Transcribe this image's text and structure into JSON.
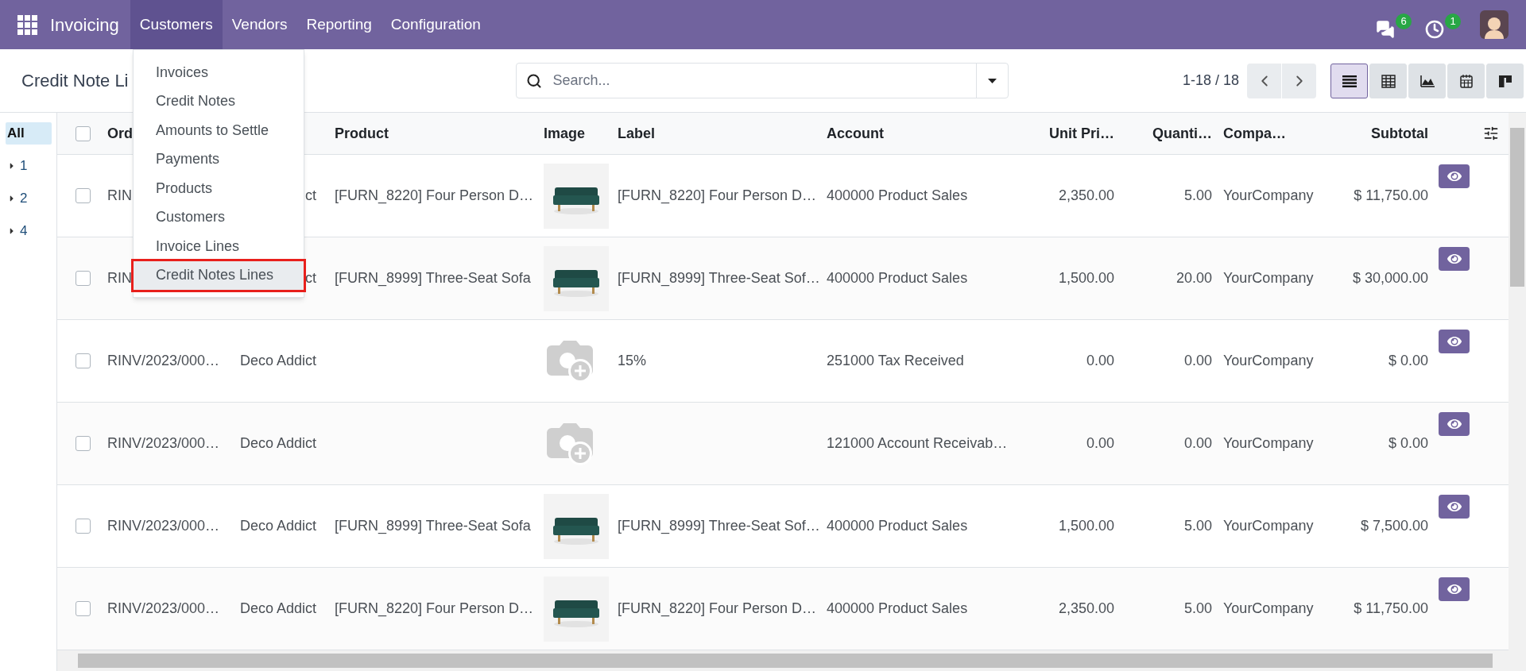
{
  "navbar": {
    "app_name": "Invoicing",
    "menus": [
      {
        "label": "Customers",
        "selected": true
      },
      {
        "label": "Vendors",
        "selected": false
      },
      {
        "label": "Reporting",
        "selected": false
      },
      {
        "label": "Configuration",
        "selected": false
      }
    ],
    "notifications": [
      {
        "kind": "chat",
        "count": "6"
      },
      {
        "kind": "activity",
        "count": "1"
      }
    ]
  },
  "customers_menu": {
    "items": [
      {
        "label": "Invoices",
        "selected": false,
        "highlighted": false
      },
      {
        "label": "Credit Notes",
        "selected": false,
        "highlighted": false
      },
      {
        "label": "Amounts to Settle",
        "selected": false,
        "highlighted": false
      },
      {
        "label": "Payments",
        "selected": false,
        "highlighted": false
      },
      {
        "label": "Products",
        "selected": false,
        "highlighted": false
      },
      {
        "label": "Customers",
        "selected": false,
        "highlighted": false
      },
      {
        "label": "Invoice Lines",
        "selected": false,
        "highlighted": false
      },
      {
        "label": "Credit Notes Lines",
        "selected": true,
        "highlighted": true
      }
    ]
  },
  "control_panel": {
    "title": "Credit Note Li",
    "search": {
      "placeholder": "Search..."
    },
    "pager": "1-18 / 18",
    "views": [
      {
        "kind": "list",
        "selected": true
      },
      {
        "kind": "pivot",
        "selected": false
      },
      {
        "kind": "graph",
        "selected": false
      },
      {
        "kind": "calendar",
        "selected": false
      },
      {
        "kind": "kanban",
        "selected": false
      }
    ]
  },
  "sidebar": {
    "items": [
      {
        "label": "All",
        "selected": true,
        "expandable": false
      },
      {
        "label": "1",
        "selected": false,
        "expandable": true
      },
      {
        "label": "2",
        "selected": false,
        "expandable": true
      },
      {
        "label": "4",
        "selected": false,
        "expandable": true
      }
    ]
  },
  "table": {
    "select_all": {
      "checked": false
    },
    "columns": {
      "order": "Ord",
      "product": "Product",
      "image": "Image",
      "label": "Label",
      "account": "Account",
      "unit_price": "Unit Pri…",
      "quantity": "Quanti…",
      "company": "Compa…",
      "subtotal": "Subtotal"
    },
    "rows": [
      {
        "checked": false,
        "order": "RIN",
        "partner": "ct",
        "product": "[FURN_8220] Four Person D…",
        "label": "[FURN_8220] Four Person D…",
        "account": "400000 Product Sales",
        "unit_price": "2,350.00",
        "quantity": "5.00",
        "company": "YourCompany",
        "subtotal": "$ 11,750.00"
      },
      {
        "checked": false,
        "order": "RIN",
        "partner": "ct",
        "product": "[FURN_8999] Three-Seat Sofa",
        "label": "[FURN_8999] Three-Seat Sof…",
        "account": "400000 Product Sales",
        "unit_price": "1,500.00",
        "quantity": "20.00",
        "company": "YourCompany",
        "subtotal": "$ 30,000.00"
      },
      {
        "checked": false,
        "order": "RINV/2023/000…",
        "partner": "Deco Addict",
        "image": {
          "kind": "placeholder"
        },
        "label": "15%",
        "account": "251000 Tax Received",
        "unit_price": "0.00",
        "quantity": "0.00",
        "company": "YourCompany",
        "subtotal": "$ 0.00"
      },
      {
        "checked": false,
        "order": "RINV/2023/000…",
        "partner": "Deco Addict",
        "image": {
          "kind": "placeholder"
        },
        "account": "121000 Account Receivab…",
        "unit_price": "0.00",
        "quantity": "0.00",
        "company": "YourCompany",
        "subtotal": "$ 0.00"
      },
      {
        "checked": false,
        "order": "RINV/2023/000…",
        "partner": "Deco Addict",
        "product": "[FURN_8999] Three-Seat Sofa",
        "label": "[FURN_8999] Three-Seat Sof…",
        "account": "400000 Product Sales",
        "unit_price": "1,500.00",
        "quantity": "5.00",
        "company": "YourCompany",
        "subtotal": "$ 7,500.00"
      },
      {
        "checked": false,
        "order": "RINV/2023/000…",
        "partner": "Deco Addict",
        "product": "[FURN_8220] Four Person D…",
        "label": "[FURN_8220] Four Person D…",
        "account": "400000 Product Sales",
        "unit_price": "2,350.00",
        "quantity": "5.00",
        "company": "YourCompany",
        "subtotal": "$ 11,750.00"
      }
    ]
  }
}
